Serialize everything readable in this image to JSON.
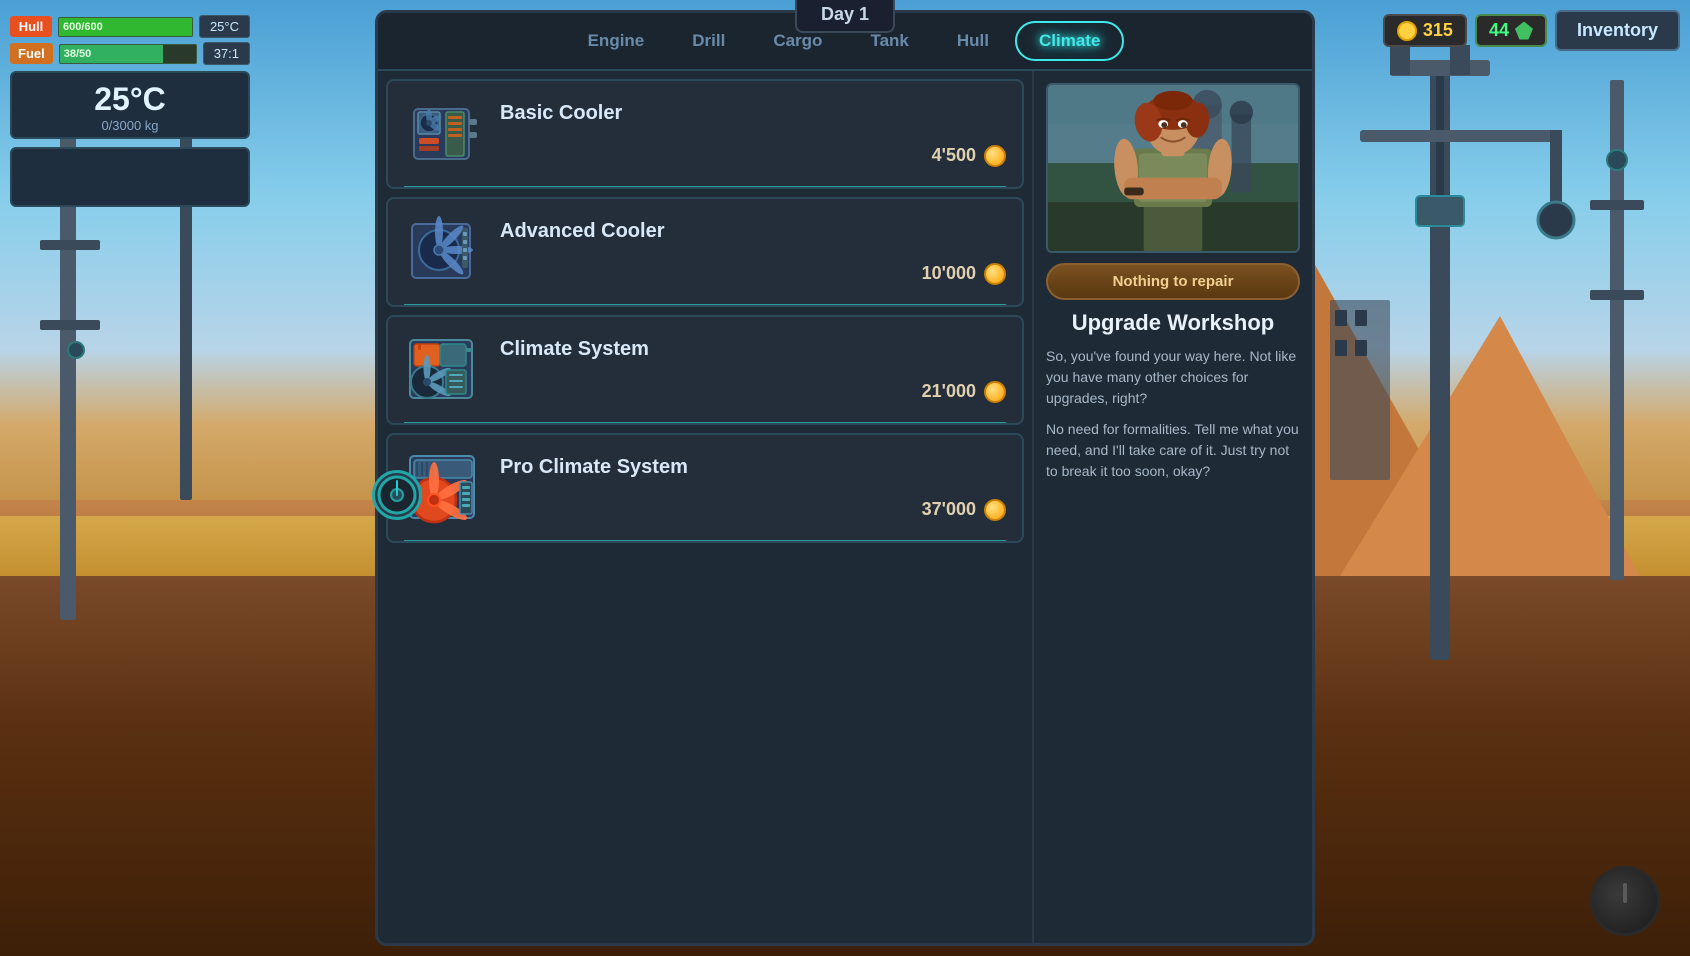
{
  "day": "Day 1",
  "hud": {
    "hull_label": "Hull",
    "hull_value": "600/600",
    "fuel_label": "Fuel",
    "fuel_value": "38/50",
    "temp_small": "25°C",
    "ratio": "37:1",
    "temp_big": "25°C",
    "weight": "0/3000 kg"
  },
  "resources": {
    "coins": "315",
    "gems": "44"
  },
  "inventory_label": "Inventory",
  "nav_tabs": [
    {
      "id": "engine",
      "label": "Engine",
      "active": false
    },
    {
      "id": "drill",
      "label": "Drill",
      "active": false
    },
    {
      "id": "cargo",
      "label": "Cargo",
      "active": false
    },
    {
      "id": "tank",
      "label": "Tank",
      "active": false
    },
    {
      "id": "hull",
      "label": "Hull",
      "active": false
    },
    {
      "id": "climate",
      "label": "Climate",
      "active": true
    }
  ],
  "shop_items": [
    {
      "id": "basic-cooler",
      "name": "Basic Cooler",
      "price": "4'500",
      "icon_type": "cooler1"
    },
    {
      "id": "advanced-cooler",
      "name": "Advanced Cooler",
      "price": "10'000",
      "icon_type": "cooler2"
    },
    {
      "id": "climate-system",
      "name": "Climate System",
      "price": "21'000",
      "icon_type": "climate1"
    },
    {
      "id": "pro-climate-system",
      "name": "Pro Climate System",
      "price": "37'000",
      "icon_type": "climate2"
    }
  ],
  "info_panel": {
    "repair_label": "Nothing to repair",
    "workshop_title": "Upgrade Workshop",
    "desc_1": "So, you've found your way here. Not like you have many other choices for upgrades, right?",
    "desc_2": "No need for formalities. Tell me what you need, and I'll take care of it. Just try not to break it too soon, okay?"
  }
}
